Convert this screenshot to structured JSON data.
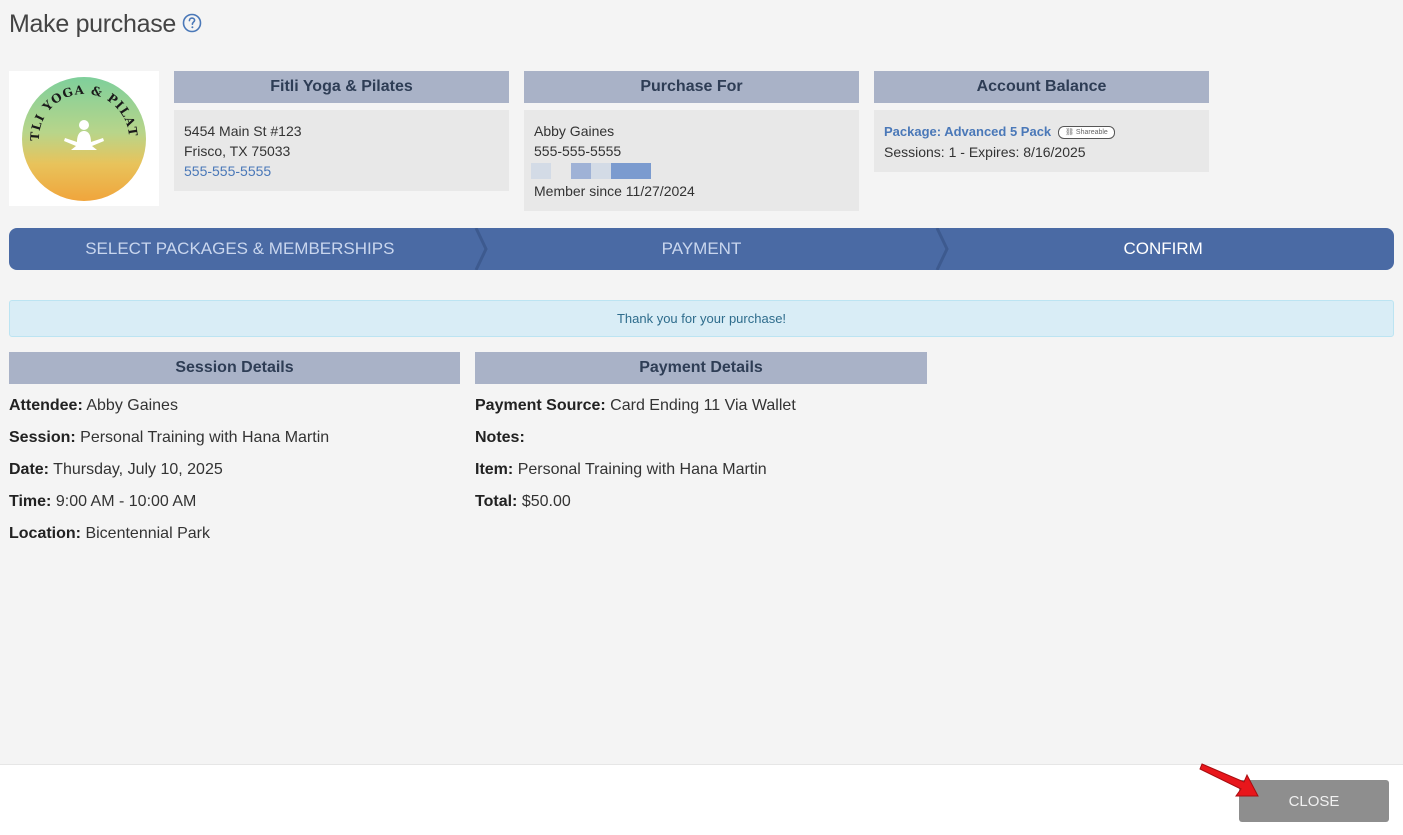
{
  "page": {
    "title": "Make purchase",
    "help_icon": "question-circle-icon"
  },
  "logo": {
    "text": "FITLI YOGA & PILATES"
  },
  "studio": {
    "header": "Fitli Yoga & Pilates",
    "address_line1": "5454 Main St #123",
    "address_line2": "Frisco, TX 75033",
    "phone": "555-555-5555"
  },
  "purchase_for": {
    "header": "Purchase For",
    "name": "Abby Gaines",
    "phone": "555-555-5555",
    "member_since": "Member since 11/27/2024"
  },
  "account_balance": {
    "header": "Account Balance",
    "package_label": "Package: Advanced 5 Pack",
    "shareable_badge": "Shareable",
    "sessions_line": "Sessions: 1 -  Expires: 8/16/2025"
  },
  "steps": {
    "items": [
      {
        "label": "SELECT PACKAGES & MEMBERSHIPS"
      },
      {
        "label": "PAYMENT"
      },
      {
        "label": "CONFIRM"
      }
    ],
    "active": "CONFIRM"
  },
  "alert": {
    "message": "Thank you for your purchase!"
  },
  "session_details": {
    "header": "Session Details",
    "rows": [
      {
        "label": "Attendee:",
        "value": "Abby Gaines"
      },
      {
        "label": "Session:",
        "value": "Personal Training with Hana Martin"
      },
      {
        "label": "Date:",
        "value": "Thursday, July 10, 2025"
      },
      {
        "label": "Time:",
        "value": "9:00 AM - 10:00 AM"
      },
      {
        "label": "Location:",
        "value": "Bicentennial Park"
      }
    ]
  },
  "payment_details": {
    "header": "Payment Details",
    "rows": [
      {
        "label": "Payment Source:",
        "value": "Card Ending 11 Via Wallet"
      },
      {
        "label": "Notes:",
        "value": ""
      },
      {
        "label": "Item:",
        "value": "Personal Training with Hana Martin"
      },
      {
        "label": "Total:",
        "value": "$50.00"
      }
    ]
  },
  "footer": {
    "close_label": "CLOSE"
  },
  "colors": {
    "steps_bg": "#4a6aa4",
    "card_header_bg": "#a9b2c7",
    "alert_bg": "#d9edf6",
    "close_button_bg": "#8e8e8e",
    "pointer_arrow": "#e8161b"
  }
}
